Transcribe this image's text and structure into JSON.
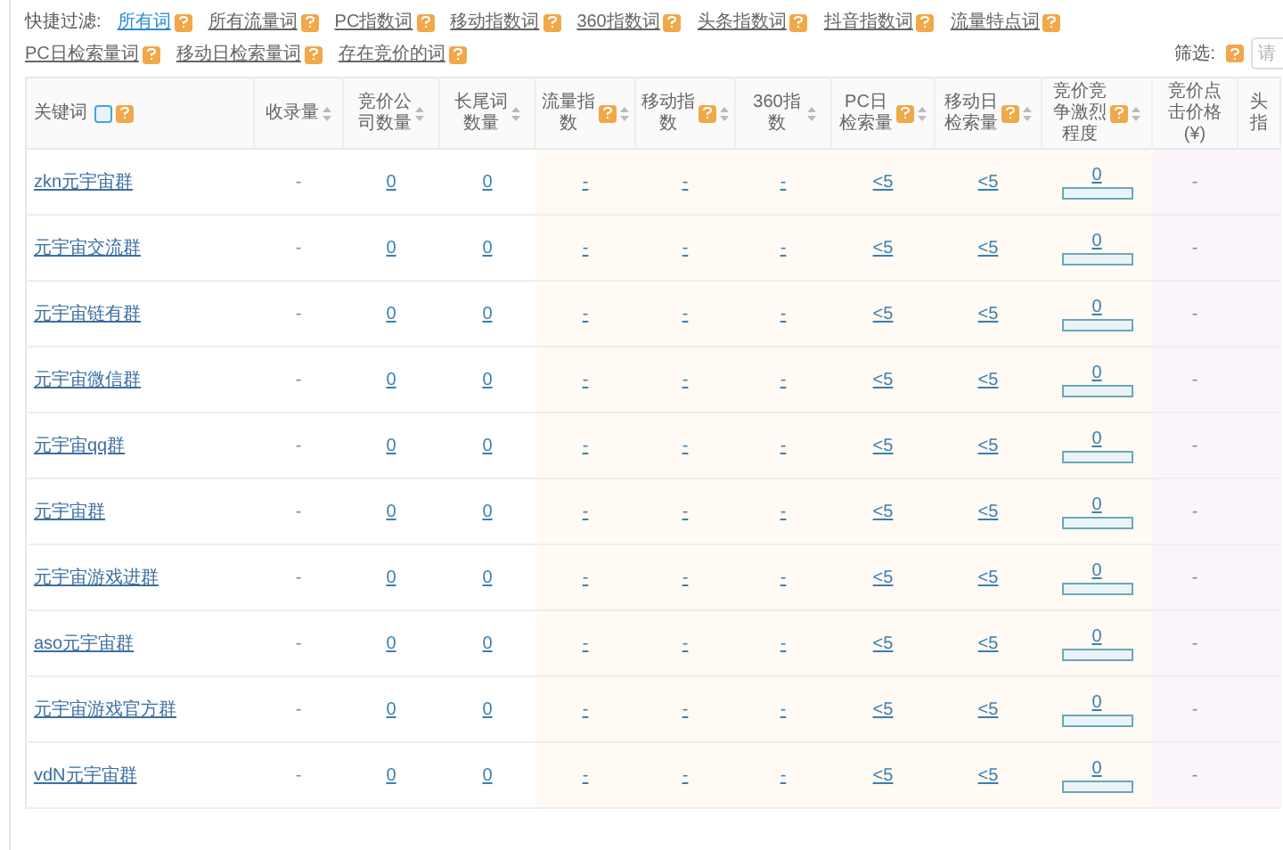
{
  "quick_filter": {
    "label": "快捷过滤:",
    "items": [
      {
        "label": "所有词",
        "selected": true
      },
      {
        "label": "所有流量词",
        "selected": false
      },
      {
        "label": "PC指数词",
        "selected": false
      },
      {
        "label": "移动指数词",
        "selected": false
      },
      {
        "label": "360指数词",
        "selected": false
      },
      {
        "label": "头条指数词",
        "selected": false
      },
      {
        "label": "抖音指数词",
        "selected": false
      },
      {
        "label": "流量特点词",
        "selected": false
      },
      {
        "label": "PC日检索量词",
        "selected": false
      },
      {
        "label": "移动日检索量词",
        "selected": false
      },
      {
        "label": "存在竞价的词",
        "selected": false
      }
    ]
  },
  "screen": {
    "label": "筛选:",
    "placeholder": "请"
  },
  "table": {
    "columns": [
      {
        "label": "关键词",
        "help": true,
        "sortable": false
      },
      {
        "label": "收录量",
        "help": false,
        "sortable": true
      },
      {
        "label": "竞价公司数量",
        "help": false,
        "sortable": true
      },
      {
        "label": "长尾词数量",
        "help": false,
        "sortable": true
      },
      {
        "label": "流量指数",
        "help": true,
        "sortable": true
      },
      {
        "label": "移动指数",
        "help": true,
        "sortable": true
      },
      {
        "label": "360指数",
        "help": false,
        "sortable": true
      },
      {
        "label": "PC日检索量",
        "help": true,
        "sortable": true
      },
      {
        "label": "移动日检索量",
        "help": true,
        "sortable": true
      },
      {
        "label": "竞价竞争激烈程度",
        "help": true,
        "sortable": true
      },
      {
        "label": "竞价点击价格(¥)",
        "help": false,
        "sortable": false
      },
      {
        "label": "头指",
        "help": false,
        "sortable": false
      }
    ],
    "rows": [
      {
        "cells": [
          "zkn元宇宙群",
          "-",
          "0",
          "0",
          "-",
          "-",
          "-",
          "<5",
          "<5",
          "0",
          "-"
        ],
        "level": 0
      },
      {
        "cells": [
          "元宇宙交流群",
          "-",
          "0",
          "0",
          "-",
          "-",
          "-",
          "<5",
          "<5",
          "0",
          "-"
        ],
        "level": 0
      },
      {
        "cells": [
          "元宇宙链有群",
          "-",
          "0",
          "0",
          "-",
          "-",
          "-",
          "<5",
          "<5",
          "0",
          "-"
        ],
        "level": 0
      },
      {
        "cells": [
          "元宇宙微信群",
          "-",
          "0",
          "0",
          "-",
          "-",
          "-",
          "<5",
          "<5",
          "0",
          "-"
        ],
        "level": 0
      },
      {
        "cells": [
          "元宇宙qq群",
          "-",
          "0",
          "0",
          "-",
          "-",
          "-",
          "<5",
          "<5",
          "0",
          "-"
        ],
        "level": 0
      },
      {
        "cells": [
          "元宇宙群",
          "-",
          "0",
          "0",
          "-",
          "-",
          "-",
          "<5",
          "<5",
          "0",
          "-"
        ],
        "level": 0
      },
      {
        "cells": [
          "元宇宙游戏进群",
          "-",
          "0",
          "0",
          "-",
          "-",
          "-",
          "<5",
          "<5",
          "0",
          "-"
        ],
        "level": 0
      },
      {
        "cells": [
          "aso元宇宙群",
          "-",
          "0",
          "0",
          "-",
          "-",
          "-",
          "<5",
          "<5",
          "0",
          "-"
        ],
        "level": 0
      },
      {
        "cells": [
          "元宇宙游戏官方群",
          "-",
          "0",
          "0",
          "-",
          "-",
          "-",
          "<5",
          "<5",
          "0",
          "-"
        ],
        "level": 0
      },
      {
        "cells": [
          "vdN元宇宙群",
          "-",
          "0",
          "0",
          "-",
          "-",
          "-",
          "<5",
          "<5",
          "0",
          "-"
        ],
        "level": 0
      }
    ]
  }
}
